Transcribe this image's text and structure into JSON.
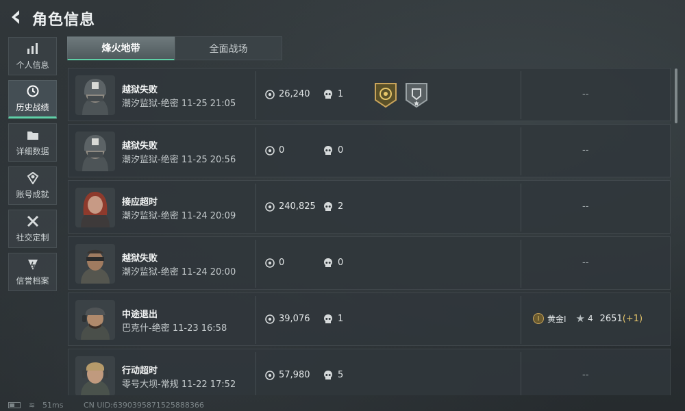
{
  "header": {
    "title": "角色信息"
  },
  "sidenav": [
    {
      "label": "个人信息",
      "icon": "bar-chart-icon"
    },
    {
      "label": "历史战绩",
      "icon": "clock-icon",
      "active": true
    },
    {
      "label": "详细数据",
      "icon": "folder-icon"
    },
    {
      "label": "账号成就",
      "icon": "achievement-icon"
    },
    {
      "label": "社交定制",
      "icon": "tools-icon"
    },
    {
      "label": "信誉档案",
      "icon": "reputation-icon"
    }
  ],
  "tabs": [
    {
      "label": "烽火地带",
      "active": true
    },
    {
      "label": "全面战场",
      "active": false
    }
  ],
  "matches": [
    {
      "result": "越狱失败",
      "map": "潮汐监狱-绝密",
      "time": "11-25 21:05",
      "coins": "26,240",
      "kills": "1",
      "badges": [
        "gold-emblem-icon",
        "silver-shield-icon"
      ],
      "extra": "--"
    },
    {
      "result": "越狱失败",
      "map": "潮汐监狱-绝密",
      "time": "11-25 20:56",
      "coins": "0",
      "kills": "0",
      "extra": "--"
    },
    {
      "result": "接应超时",
      "map": "潮汐监狱-绝密",
      "time": "11-24 20:09",
      "coins": "240,825",
      "kills": "2",
      "extra": "--"
    },
    {
      "result": "越狱失败",
      "map": "潮汐监狱-绝密",
      "time": "11-24 20:00",
      "coins": "0",
      "kills": "0",
      "extra": "--"
    },
    {
      "result": "中途退出",
      "map": "巴克什-绝密",
      "time": "11-23 16:58",
      "coins": "39,076",
      "kills": "1",
      "rank": {
        "medal": "I",
        "tier": "黄金I",
        "stars": "4",
        "score": "2651",
        "delta": "(+1)"
      }
    },
    {
      "result": "行动超时",
      "map": "零号大坝-常规",
      "time": "11-22 17:52",
      "coins": "57,980",
      "kills": "5",
      "extra": "--"
    }
  ],
  "footer": {
    "ping": "51ms",
    "uid": "CN UID:6390395871525888366"
  },
  "colors": {
    "accent": "#5fd0a7",
    "gold": "#c9a45b"
  }
}
